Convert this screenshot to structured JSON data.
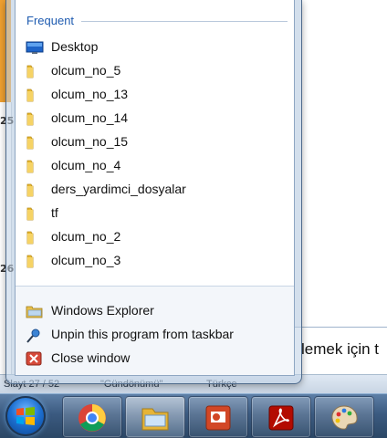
{
  "background": {
    "notes_text": "lemek için t",
    "status_slide": "Slayt 27 / 52",
    "status_theme": "\"Gündönümü\"",
    "status_lang": "Türkçe",
    "sidebar_numbers": [
      "25",
      "26"
    ]
  },
  "jumplist": {
    "frequent_header": "Frequent",
    "frequent_items": [
      {
        "label": "Desktop",
        "icon": "desktop-icon"
      },
      {
        "label": "olcum_no_5",
        "icon": "folder-icon"
      },
      {
        "label": "olcum_no_13",
        "icon": "folder-icon"
      },
      {
        "label": "olcum_no_14",
        "icon": "folder-icon"
      },
      {
        "label": "olcum_no_15",
        "icon": "folder-icon"
      },
      {
        "label": "olcum_no_4",
        "icon": "folder-icon"
      },
      {
        "label": "ders_yardimci_dosyalar",
        "icon": "folder-icon"
      },
      {
        "label": "tf",
        "icon": "folder-icon"
      },
      {
        "label": "olcum_no_2",
        "icon": "folder-icon"
      },
      {
        "label": "olcum_no_3",
        "icon": "folder-icon"
      }
    ],
    "tasks": [
      {
        "label": "Windows Explorer",
        "icon": "windows-explorer-icon"
      },
      {
        "label": "Unpin this program from taskbar",
        "icon": "unpin-icon"
      },
      {
        "label": "Close window",
        "icon": "close-window-icon"
      }
    ]
  },
  "taskbar": {
    "buttons": [
      {
        "name": "chrome",
        "icon": "chrome-icon"
      },
      {
        "name": "windows-explorer",
        "icon": "explorer-folder-icon",
        "active": true
      },
      {
        "name": "powerpoint",
        "icon": "powerpoint-icon"
      },
      {
        "name": "adobe-reader",
        "icon": "acrobat-icon"
      },
      {
        "name": "paint",
        "icon": "paint-palette-icon"
      }
    ]
  }
}
